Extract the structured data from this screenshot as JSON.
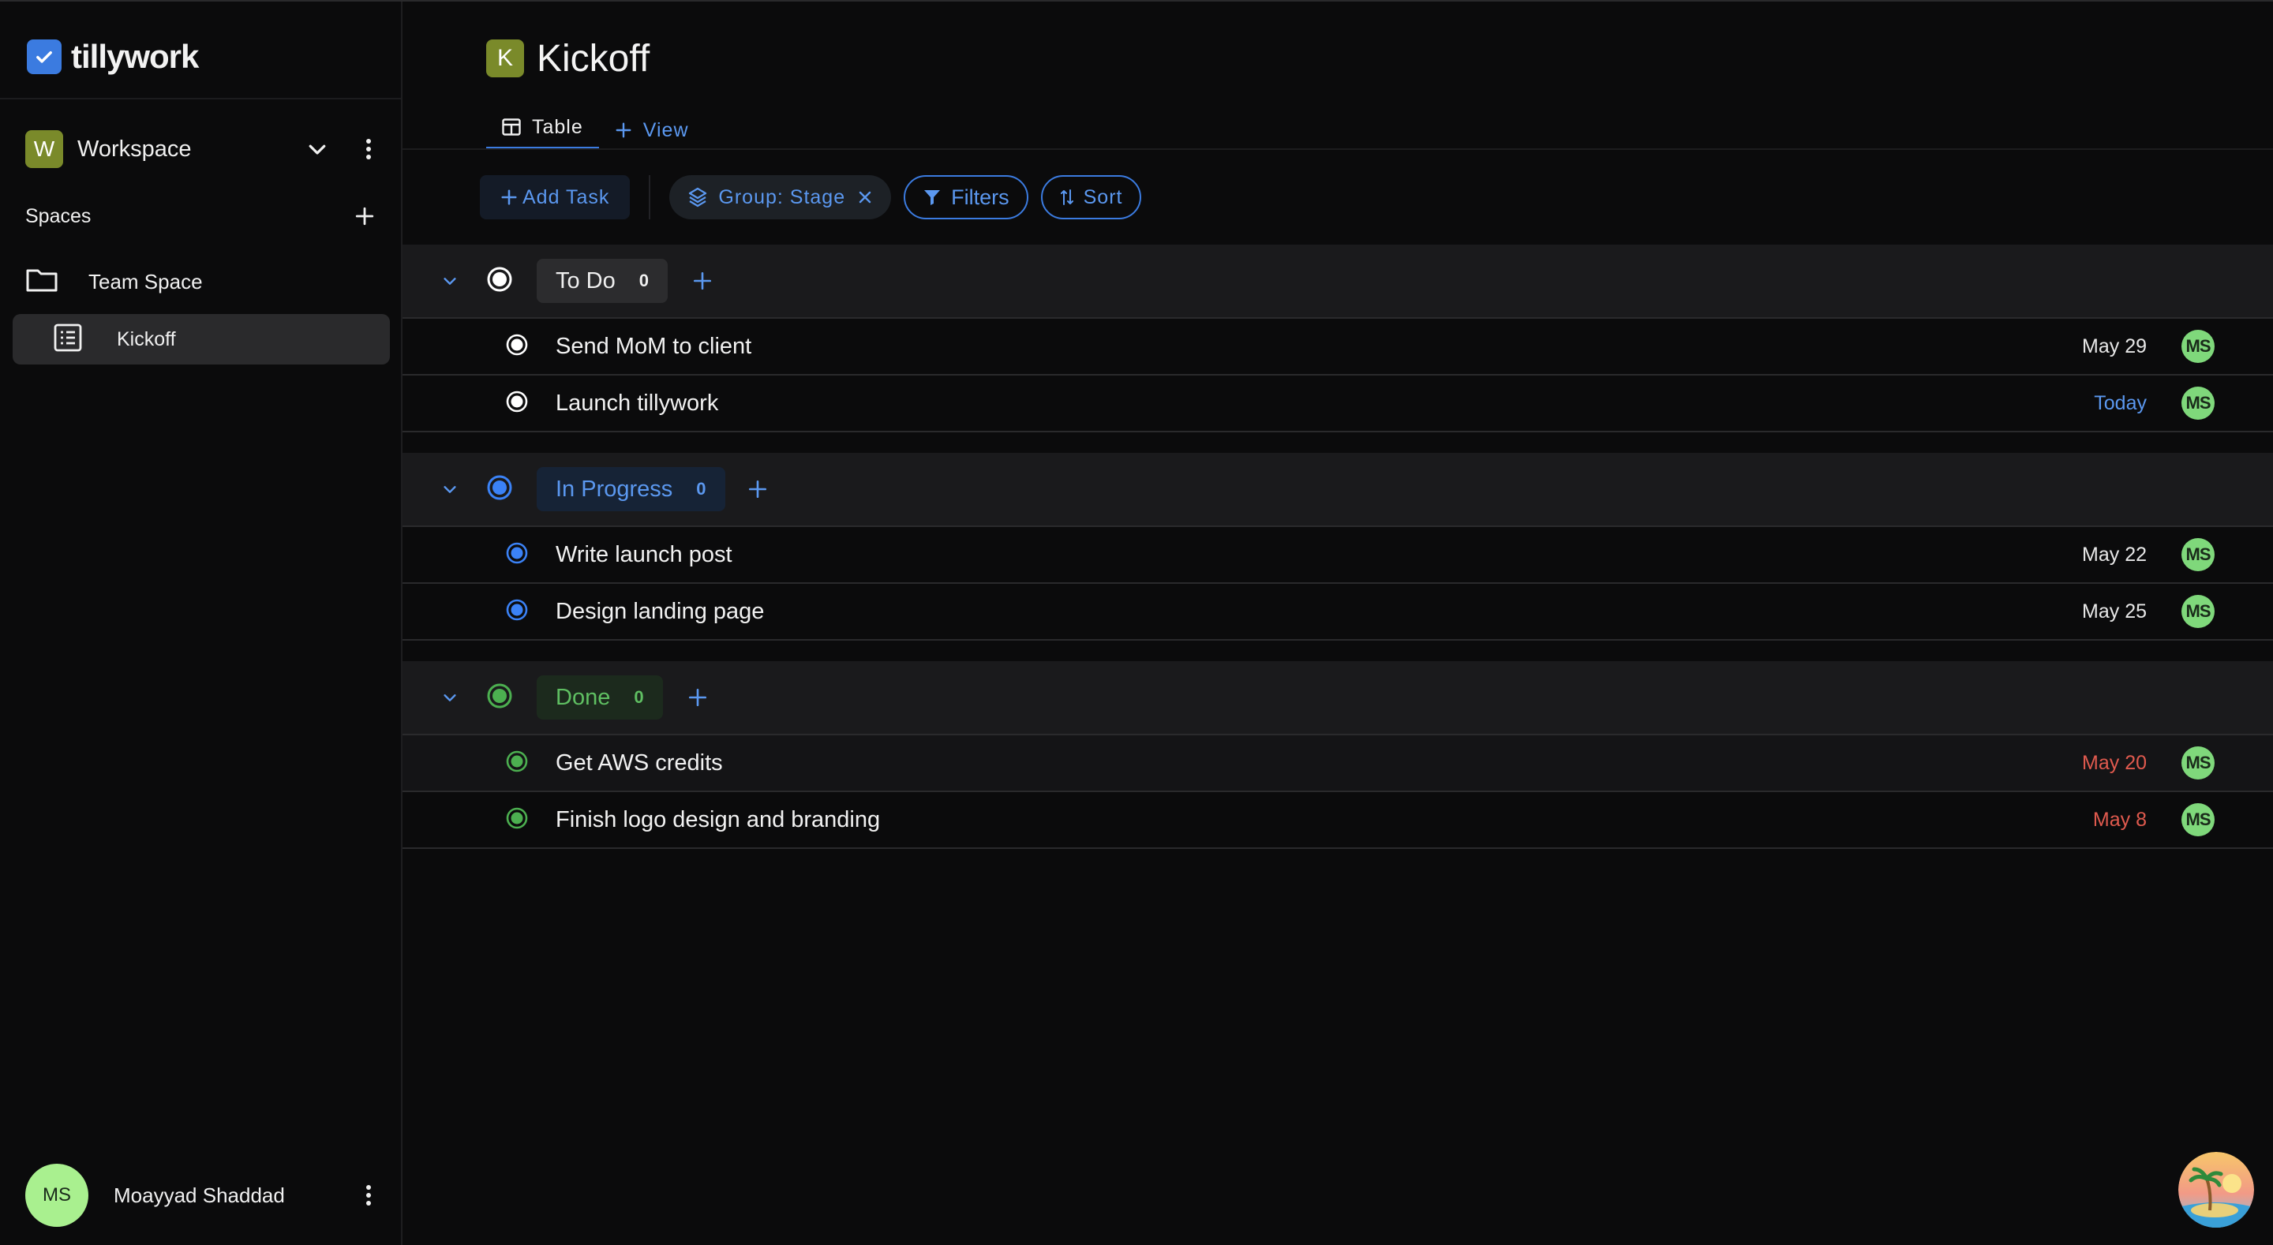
{
  "app": {
    "name": "tillywork"
  },
  "sidebar": {
    "workspace": {
      "initial": "W",
      "name": "Workspace"
    },
    "spaces_label": "Spaces",
    "team_space": "Team Space",
    "list_item": "Kickoff",
    "user": {
      "initials": "MS",
      "name": "Moayyad Shaddad"
    }
  },
  "header": {
    "badge": "K",
    "title": "Kickoff"
  },
  "tabs": {
    "table": "Table",
    "add_view": "View"
  },
  "toolbar": {
    "add_task": "Add Task",
    "group": "Group: Stage",
    "filters": "Filters",
    "sort": "Sort"
  },
  "groups": [
    {
      "label": "To Do",
      "count": "0",
      "color": "#ffffff",
      "tasks": [
        {
          "title": "Send MoM to client",
          "date": "May 29",
          "date_color": "#e8e8e8",
          "assignee": "MS"
        },
        {
          "title": "Launch tillywork",
          "date": "Today",
          "date_color": "#5b98f0",
          "assignee": "MS"
        }
      ]
    },
    {
      "label": "In Progress",
      "count": "0",
      "color": "#3b82f6",
      "tasks": [
        {
          "title": "Write launch post",
          "date": "May 22",
          "date_color": "#e8e8e8",
          "assignee": "MS"
        },
        {
          "title": "Design landing page",
          "date": "May 25",
          "date_color": "#e8e8e8",
          "assignee": "MS"
        }
      ]
    },
    {
      "label": "Done",
      "count": "0",
      "color": "#4caf50",
      "tasks": [
        {
          "title": "Get AWS credits",
          "date": "May 20",
          "date_color": "#e05a4e",
          "assignee": "MS"
        },
        {
          "title": "Finish logo design and branding",
          "date": "May 8",
          "date_color": "#e05a4e",
          "assignee": "MS"
        }
      ]
    }
  ],
  "colors": {
    "accent": "#3b7be0",
    "sidebar_bg": "#0b0b0c",
    "selected_bg": "#2a2a2c"
  }
}
